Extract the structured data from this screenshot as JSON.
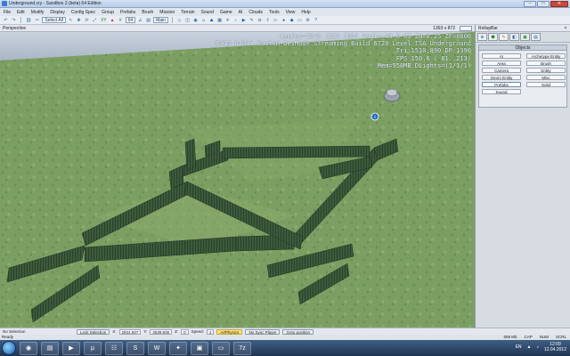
{
  "window": {
    "title": "Underground.cry - Sandbox 2 (beta) 64 Edition",
    "close_glyph": "✕",
    "min_glyph": "–",
    "max_glyph": "□"
  },
  "menu": [
    "File",
    "Edit",
    "Modify",
    "Display",
    "Config Spec",
    "Group",
    "Prefabs",
    "Brush",
    "Mission",
    "Terrain",
    "Sound",
    "Game",
    "AI",
    "Clouds",
    "Tools",
    "View",
    "Help"
  ],
  "toolbar": {
    "select_label": "Select All",
    "layer_label": "Main",
    "grid_value": "64"
  },
  "viewport": {
    "title": "Perspective",
    "resolution": "1393 x 872",
    "stats": [
      "CamPos=2949 1352 1004 Angl=-49  0  63 ZN=0.25 ZF=8000",
      "DX10 64bit Custom DevMode Streaming Build 6720 Level TSA Underground",
      "Tri:1510,890 DP:1390",
      "FPS 150.6 ( 81..213)",
      "Mem=558MB DLights=(1/1/1)"
    ]
  },
  "rollup": {
    "title": "RollupBar",
    "panel_title": "Objects",
    "buttons": [
      "AI",
      "Archetype Entity",
      "Area",
      "Brush",
      "Camera",
      "Entity",
      "Geom Entity",
      "Misc",
      "Prefabs",
      "Solid",
      "Sound"
    ],
    "selected": "Prefabs"
  },
  "statusbar": {
    "selection": "No Selection",
    "lock_selection": "Lock Selection",
    "x_label": "X:",
    "x_value": "2924.937",
    "y_label": "Y:",
    "y_value": "2539.836",
    "z_label": "Z:",
    "z_value": "0",
    "speed_label": "Speed:",
    "speed_value": "1",
    "ai_physics": "AI/Physics",
    "no_sync_player": "No Sync Player",
    "goto_position": "Goto position"
  },
  "readybar": {
    "status": "Ready",
    "memory": "558 Mb",
    "caps": "CAP",
    "num": "NUM",
    "scrl": "SCRL"
  },
  "taskbar": {
    "lang": "EN",
    "time": "12:09",
    "date": "12.04.2012"
  },
  "colors": {
    "grass": "#7b9f62",
    "wall": "#3a5a3a",
    "panel_bg": "#d7dce3"
  }
}
